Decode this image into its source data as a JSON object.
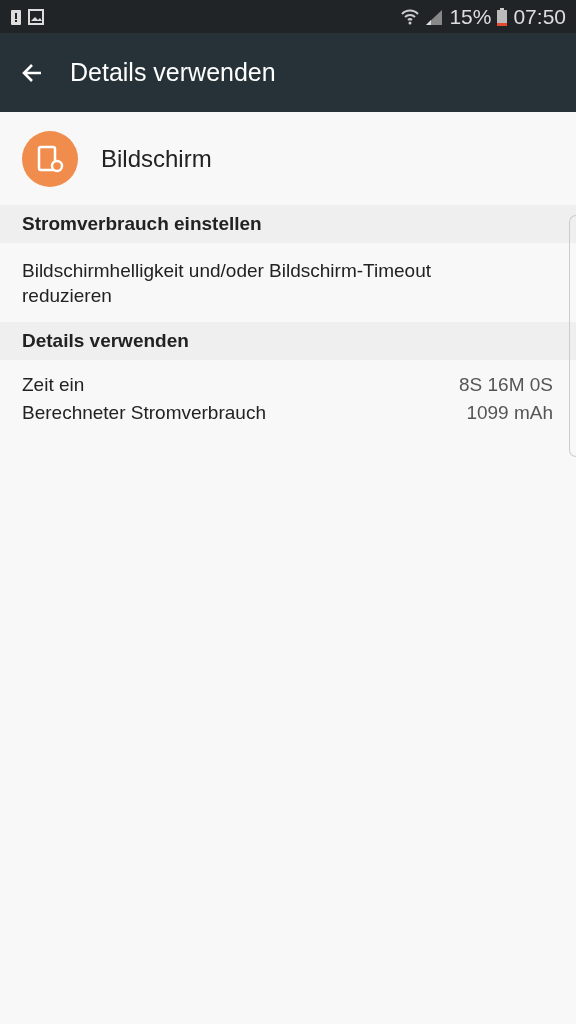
{
  "status_bar": {
    "battery_percent": "15%",
    "time": "07:50"
  },
  "app_bar": {
    "title": "Details verwenden"
  },
  "app": {
    "name": "Bildschirm"
  },
  "sections": [
    {
      "header": "Stromverbrauch einstellen",
      "kind": "text",
      "text": "Bildschirmhelligkeit und/oder Bildschirm-Timeout reduzieren"
    },
    {
      "header": "Details verwenden",
      "kind": "rows",
      "rows": [
        {
          "label": "Zeit ein",
          "value": "8S 16M 0S"
        },
        {
          "label": "Berechneter Stromverbrauch",
          "value": "1099 mAh"
        }
      ]
    }
  ]
}
